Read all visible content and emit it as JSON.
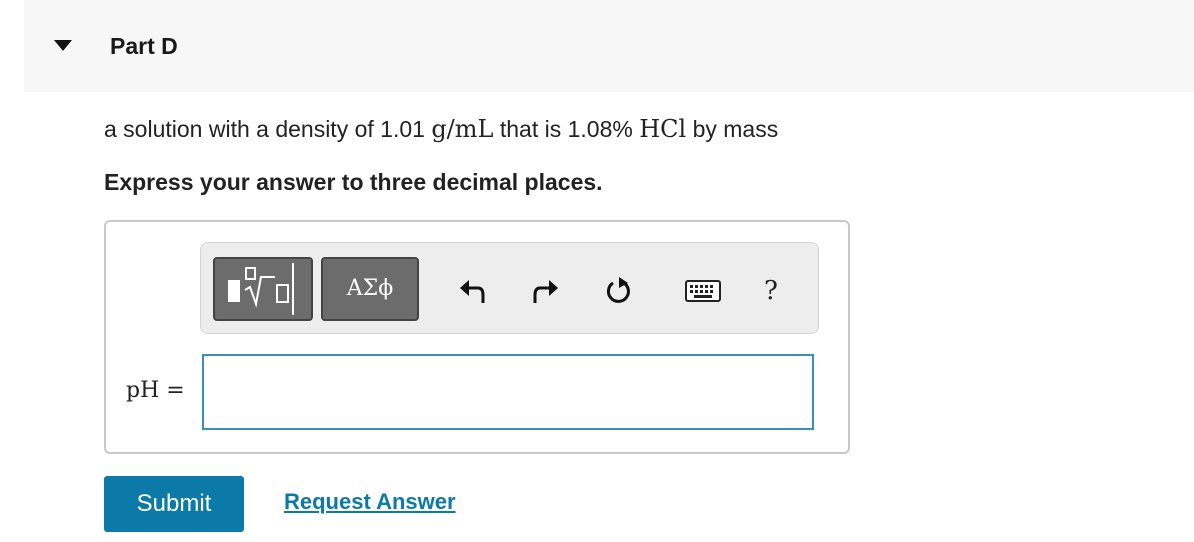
{
  "part": {
    "caret_icon": "triangle-down-icon",
    "title": "Part D"
  },
  "question": {
    "prefix": "a solution with a density of 1.01",
    "unit": "g/mL",
    "middle": "that is 1.08%",
    "compound": "HCl",
    "suffix": "by mass"
  },
  "instruction": "Express your answer to three decimal places.",
  "toolbar": {
    "template_icon": "radical-template-icon",
    "greek_label": "ΑΣϕ",
    "undo_icon": "undo-icon",
    "redo_icon": "redo-icon",
    "reset_icon": "reset-icon",
    "keyboard_icon": "keyboard-icon",
    "help_label": "?"
  },
  "answer": {
    "label": "pH =",
    "value": "",
    "placeholder": ""
  },
  "actions": {
    "submit_label": "Submit",
    "request_label": "Request Answer"
  },
  "colors": {
    "accent": "#0c7aa8",
    "input_border": "#3a8fb7",
    "toolbar_button": "#6c6c6c"
  }
}
